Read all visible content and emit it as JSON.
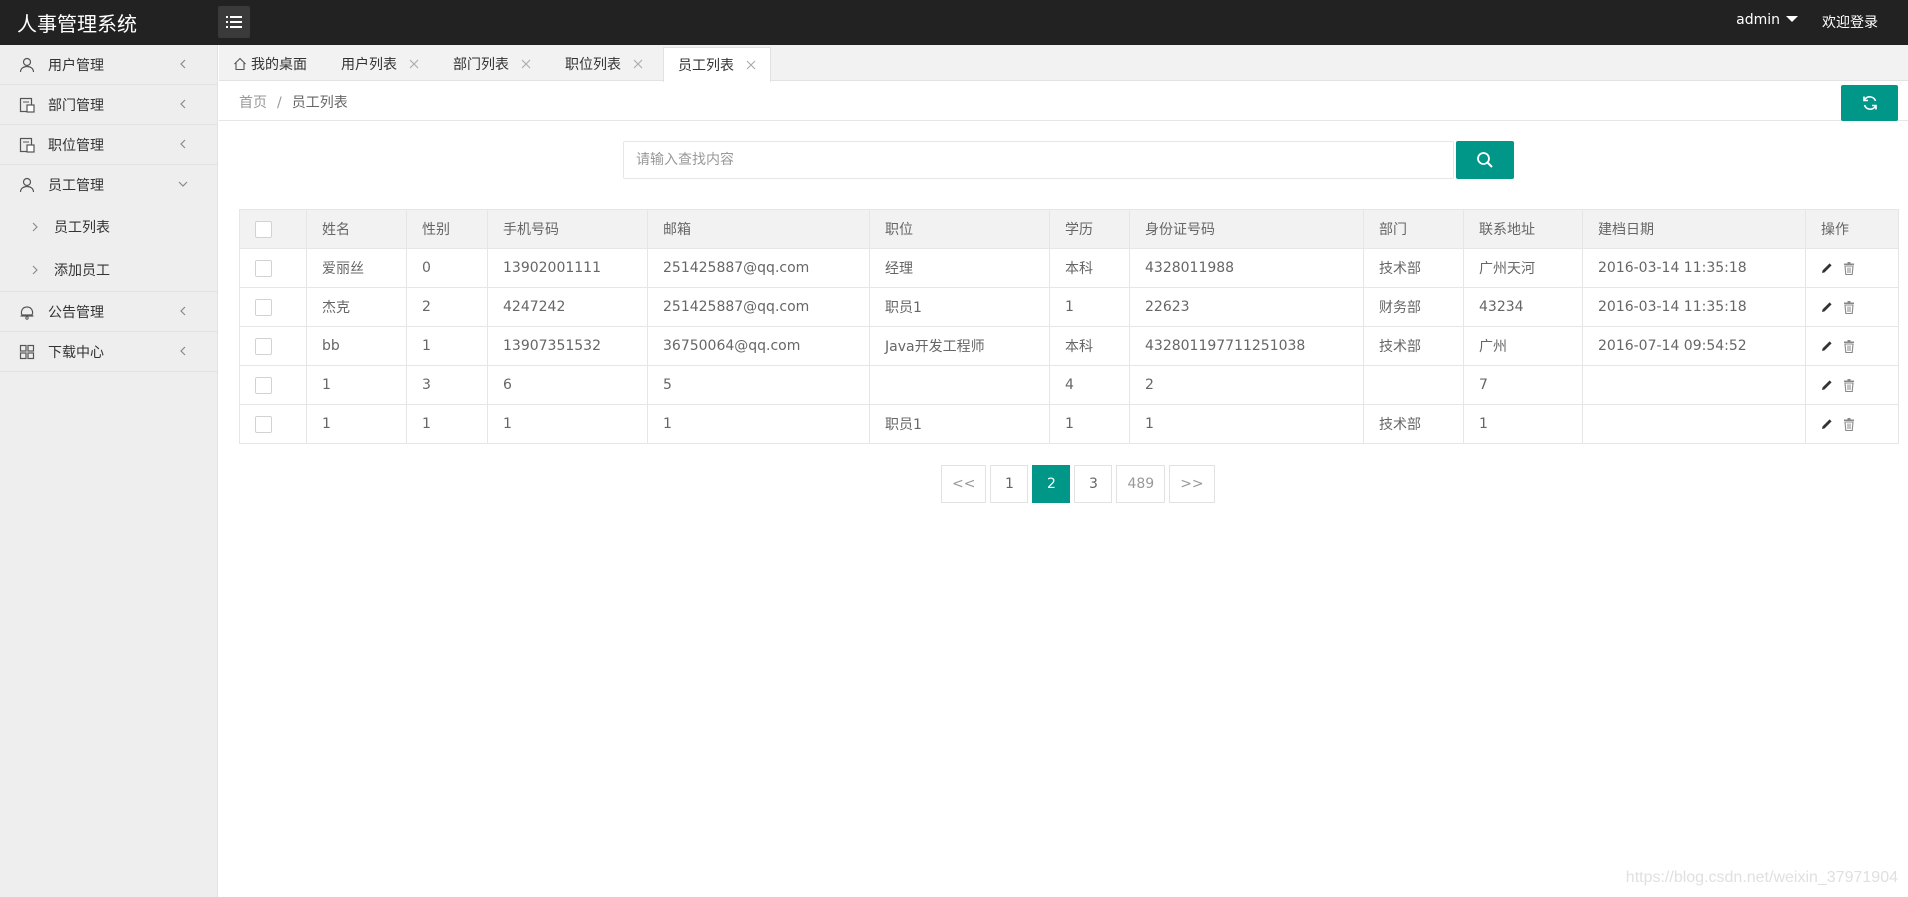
{
  "app": {
    "title": "人事管理系统"
  },
  "header": {
    "user": "admin",
    "welcome": "欢迎登录"
  },
  "sidebar": {
    "items": [
      {
        "label": "用户管理",
        "icon": "user-icon",
        "expanded": false
      },
      {
        "label": "部门管理",
        "icon": "department-icon",
        "expanded": false
      },
      {
        "label": "职位管理",
        "icon": "position-icon",
        "expanded": false
      },
      {
        "label": "员工管理",
        "icon": "employee-icon",
        "expanded": true,
        "children": [
          "员工列表",
          "添加员工"
        ]
      },
      {
        "label": "公告管理",
        "icon": "notice-icon",
        "expanded": false
      },
      {
        "label": "下载中心",
        "icon": "grid-icon",
        "expanded": false
      }
    ]
  },
  "tabs": [
    {
      "label": "我的桌面",
      "closable": false
    },
    {
      "label": "用户列表",
      "closable": true
    },
    {
      "label": "部门列表",
      "closable": true
    },
    {
      "label": "职位列表",
      "closable": true
    },
    {
      "label": "员工列表",
      "closable": true,
      "active": true
    }
  ],
  "breadcrumb": {
    "home": "首页",
    "separator": "/",
    "current": "员工列表"
  },
  "search": {
    "placeholder": "请输入查找内容",
    "value": ""
  },
  "table": {
    "headers": [
      "",
      "姓名",
      "性别",
      "手机号码",
      "邮箱",
      "职位",
      "学历",
      "身份证号码",
      "部门",
      "联系地址",
      "建档日期",
      "操作"
    ],
    "rows": [
      [
        "爱丽丝",
        "0",
        "13902001111",
        "251425887@qq.com",
        "经理",
        "本科",
        "4328011988",
        "技术部",
        "广州天河",
        "2016-03-14 11:35:18"
      ],
      [
        "杰克",
        "2",
        "4247242",
        "251425887@qq.com",
        "职员1",
        "1",
        "22623",
        "财务部",
        "43234",
        "2016-03-14 11:35:18"
      ],
      [
        "bb",
        "1",
        "13907351532",
        "36750064@qq.com",
        "Java开发工程师",
        "本科",
        "432801197711251038",
        "技术部",
        "广州",
        "2016-07-14 09:54:52"
      ],
      [
        "1",
        "3",
        "6",
        "5",
        "",
        "4",
        "2",
        "",
        "7",
        ""
      ],
      [
        "1",
        "1",
        "1",
        "1",
        "职员1",
        "1",
        "1",
        "技术部",
        "1",
        ""
      ]
    ]
  },
  "pagination": {
    "prev": "<<",
    "pages": [
      "1",
      "2",
      "3",
      "489"
    ],
    "current": "2",
    "next": ">>"
  },
  "watermark": "https://blog.csdn.net/weixin_37971904",
  "colors": {
    "accent": "#009688",
    "header_bg": "#222222",
    "sidebar_bg": "#eeeeee"
  }
}
